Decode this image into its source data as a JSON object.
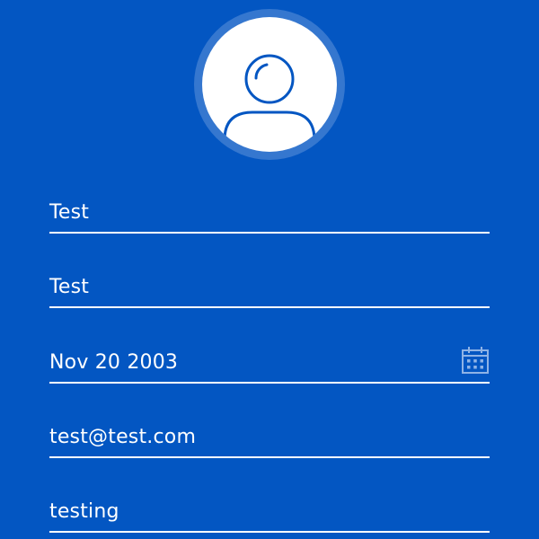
{
  "profile": {
    "avatar_icon": "user-profile-icon"
  },
  "form": {
    "first_name": "Test",
    "last_name": "Test",
    "birthdate": "Nov 20 2003",
    "email": "test@test.com",
    "password": "testing",
    "calendar_icon": "calendar-icon"
  },
  "colors": {
    "background": "#0356c2",
    "avatar_ring": "#3577cf",
    "avatar_fill": "#ffffff",
    "icon_stroke": "#0356c2",
    "underline": "#ffffff"
  }
}
